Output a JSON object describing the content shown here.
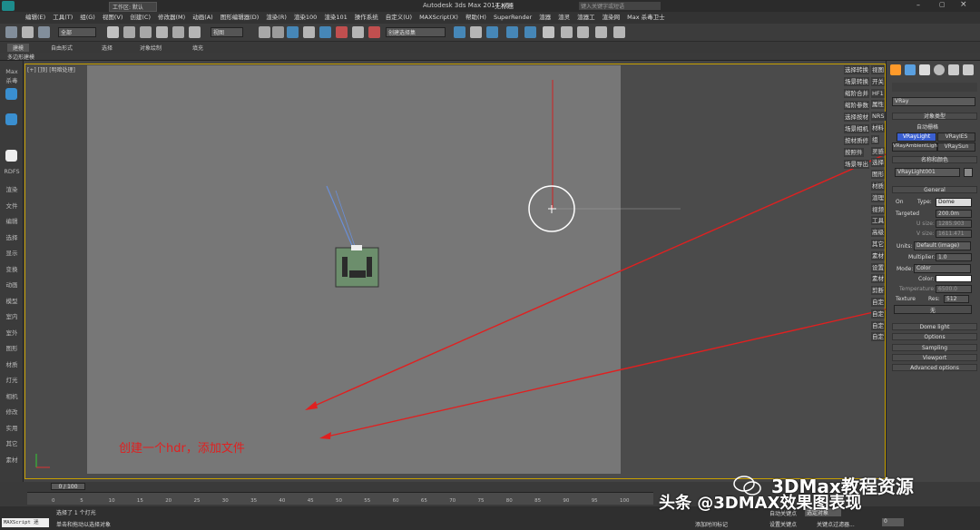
{
  "titlebar": {
    "workspace": "工作区: 默认",
    "app": "Autodesk 3ds Max  2014 x64",
    "doc": "无标题",
    "search": "键入关键字或短语"
  },
  "menu": [
    "编辑(E)",
    "工具(T)",
    "组(G)",
    "视图(V)",
    "创建(C)",
    "修改器(M)",
    "动画(A)",
    "图形编辑器(D)",
    "渲染(R)",
    "渲染100",
    "渲染101",
    "操作系统",
    "自定义(U)",
    "MAXScript(X)",
    "帮助(H)",
    "SuperRender",
    "渲器",
    "渲灵",
    "渲器工",
    "渲染网",
    "Max 杀毒卫士"
  ],
  "toolbar": {
    "select_filter": "全部",
    "ref_coord": "视图",
    "named_sel": "创建选择集"
  },
  "ribbon": {
    "tabs": [
      "建模",
      "自由形式",
      "选择",
      "对象绘制",
      "填充"
    ],
    "sub": "多边形建模"
  },
  "left_tools": [
    "Max",
    "杀毒",
    "RDFS",
    "渲染",
    "文件",
    "编辑",
    "选择",
    "显示",
    "变换",
    "动画",
    "模型",
    "室内",
    "室外",
    "图形",
    "材质",
    "灯光",
    "相机",
    "修改",
    "实用",
    "其它",
    "素材"
  ],
  "viewport": {
    "label": "[+] [顶] [明暗处理]",
    "annotation": "创建一个hdr，添加文件"
  },
  "right_labels": [
    "选择转换",
    "场景转换",
    "缩阶合并",
    "缩阶参数",
    "选择按材",
    "场景相机",
    "按材质修",
    "按照件",
    "场景导出"
  ],
  "right_labels_col2": [
    "视图",
    "开关",
    "HF1",
    "属性",
    "NRS",
    "材料",
    "组",
    "灵感",
    "选择",
    "图形",
    "材质",
    "渲理",
    "视频",
    "工具",
    "高级",
    "其它",
    "素材",
    "设置",
    "素材",
    "剪断",
    "自定",
    "自定",
    "自定",
    "自定"
  ],
  "cmd": {
    "renderer": "VRay",
    "rollout_object_type": "对象类型",
    "autogrid": "自动栅格",
    "btn_vraylight": "VRayLight",
    "btn_vrayies": "VRayIES",
    "btn_vrayambient": "VRayAmbientLigh",
    "btn_vraysun": "VRaySun",
    "rollout_name": "名称和颜色",
    "name_value": "VRayLight001",
    "rollout_general": "General",
    "on_label": "On",
    "type_label": "Type:",
    "type_value": "Dome",
    "targeted_label": "Targeted",
    "targeted_value": "200.0m",
    "usize": "U size:",
    "usize_value": "1285.903",
    "vsize": "V size:",
    "vsize_value": "1611.471",
    "units_label": "Units:",
    "units_value": "Default (image)",
    "multiplier_label": "Multiplier:",
    "multiplier_value": "1.0",
    "mode_label": "Mode:",
    "mode_value": "Color",
    "color_label": "Color:",
    "temp_label": "Temperature:",
    "temp_value": "6500.0",
    "texture_label": "Texture",
    "res_label": "Res:",
    "res_value": "512",
    "none_btn": "无",
    "rollouts": [
      "Dome light",
      "Options",
      "Sampling",
      "Viewport",
      "Advanced options"
    ]
  },
  "timeline": {
    "frame": "0 / 100",
    "ticks": [
      "0",
      "5",
      "10",
      "15",
      "20",
      "25",
      "30",
      "35",
      "40",
      "45",
      "50",
      "55",
      "60",
      "65",
      "70",
      "75",
      "80",
      "85",
      "90",
      "95",
      "100"
    ]
  },
  "status": {
    "maxscript": "MAXScript 迷",
    "selected": "选择了 1 个灯光",
    "prompt": "单击和拖动以选择对象",
    "addtime": "添加时间标记",
    "autokey": "自动关键点",
    "setkey": "设置关键点",
    "filter": "关键点过滤器...",
    "selobj": "选定对象",
    "frameval": "0"
  },
  "watermark": {
    "brand": "3DMax教程资源",
    "toutiao": "头条 @3DMAX效果图表现"
  },
  "colors": {
    "annotation": "#e02020",
    "selected_button": "#3a5fd0",
    "viewport_border": "#c8a000"
  }
}
